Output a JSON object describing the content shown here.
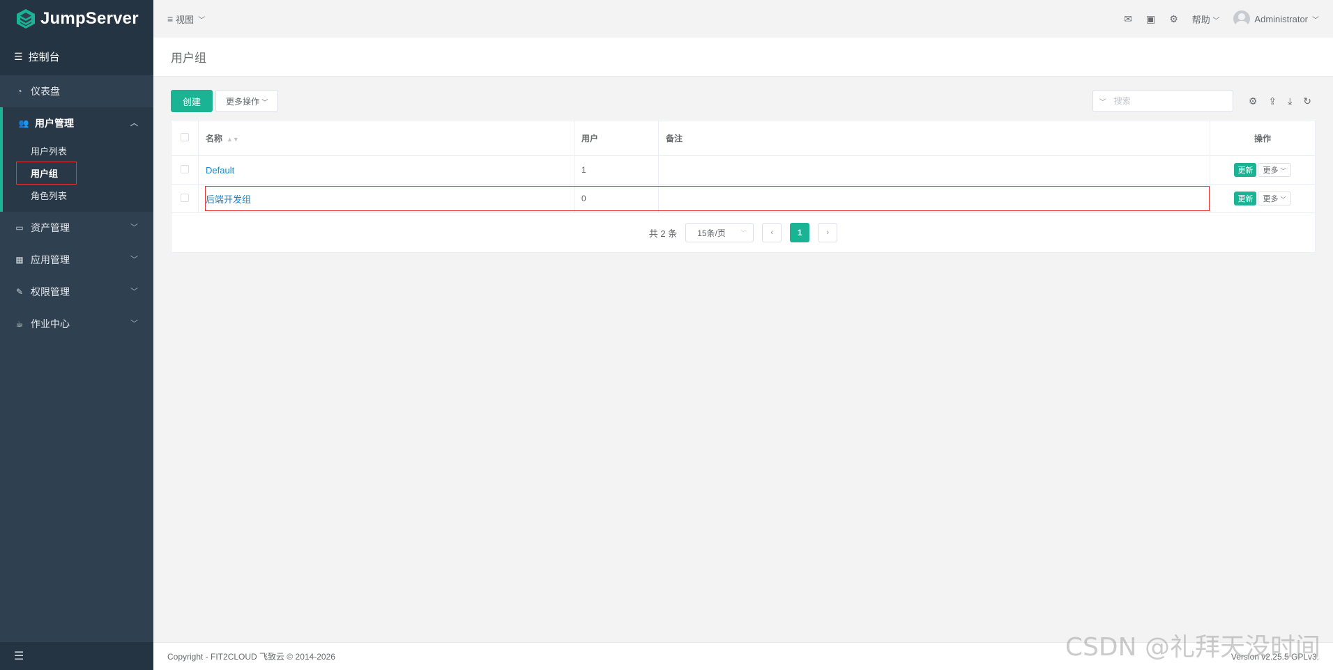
{
  "brand": {
    "name": "JumpServer"
  },
  "sidebar": {
    "console_label": "控制台",
    "dashboard_label": "仪表盘",
    "user_mgmt": {
      "label": "用户管理",
      "items": [
        "用户列表",
        "用户组",
        "角色列表"
      ]
    },
    "asset_mgmt_label": "资产管理",
    "app_mgmt_label": "应用管理",
    "perm_mgmt_label": "权限管理",
    "job_center_label": "作业中心"
  },
  "topbar": {
    "view_label": "视图",
    "help_label": "帮助",
    "username": "Administrator"
  },
  "page": {
    "title": "用户组"
  },
  "toolbar": {
    "create_label": "创建",
    "more_actions_label": "更多操作",
    "search_placeholder": "搜索"
  },
  "table": {
    "headers": {
      "name": "名称",
      "users": "用户",
      "comment": "备注",
      "actions": "操作"
    },
    "rows": [
      {
        "name": "Default",
        "users": "1",
        "comment": ""
      },
      {
        "name": "后端开发组",
        "users": "0",
        "comment": ""
      }
    ],
    "update_label": "更新",
    "more_label": "更多"
  },
  "pagination": {
    "total_label": "共 2 条",
    "page_size_label": "15条/页",
    "current_page": "1"
  },
  "footer": {
    "copyright": "Copyright - FIT2CLOUD 飞致云 © 2014-2026",
    "version": "Version v2.25.5 GPLv3."
  },
  "watermark": "CSDN @礼拜天没时间",
  "colors": {
    "accent": "#1ab394",
    "sidebar": "#2f4050",
    "link": "#1c84c6",
    "highlight": "#e53935"
  }
}
